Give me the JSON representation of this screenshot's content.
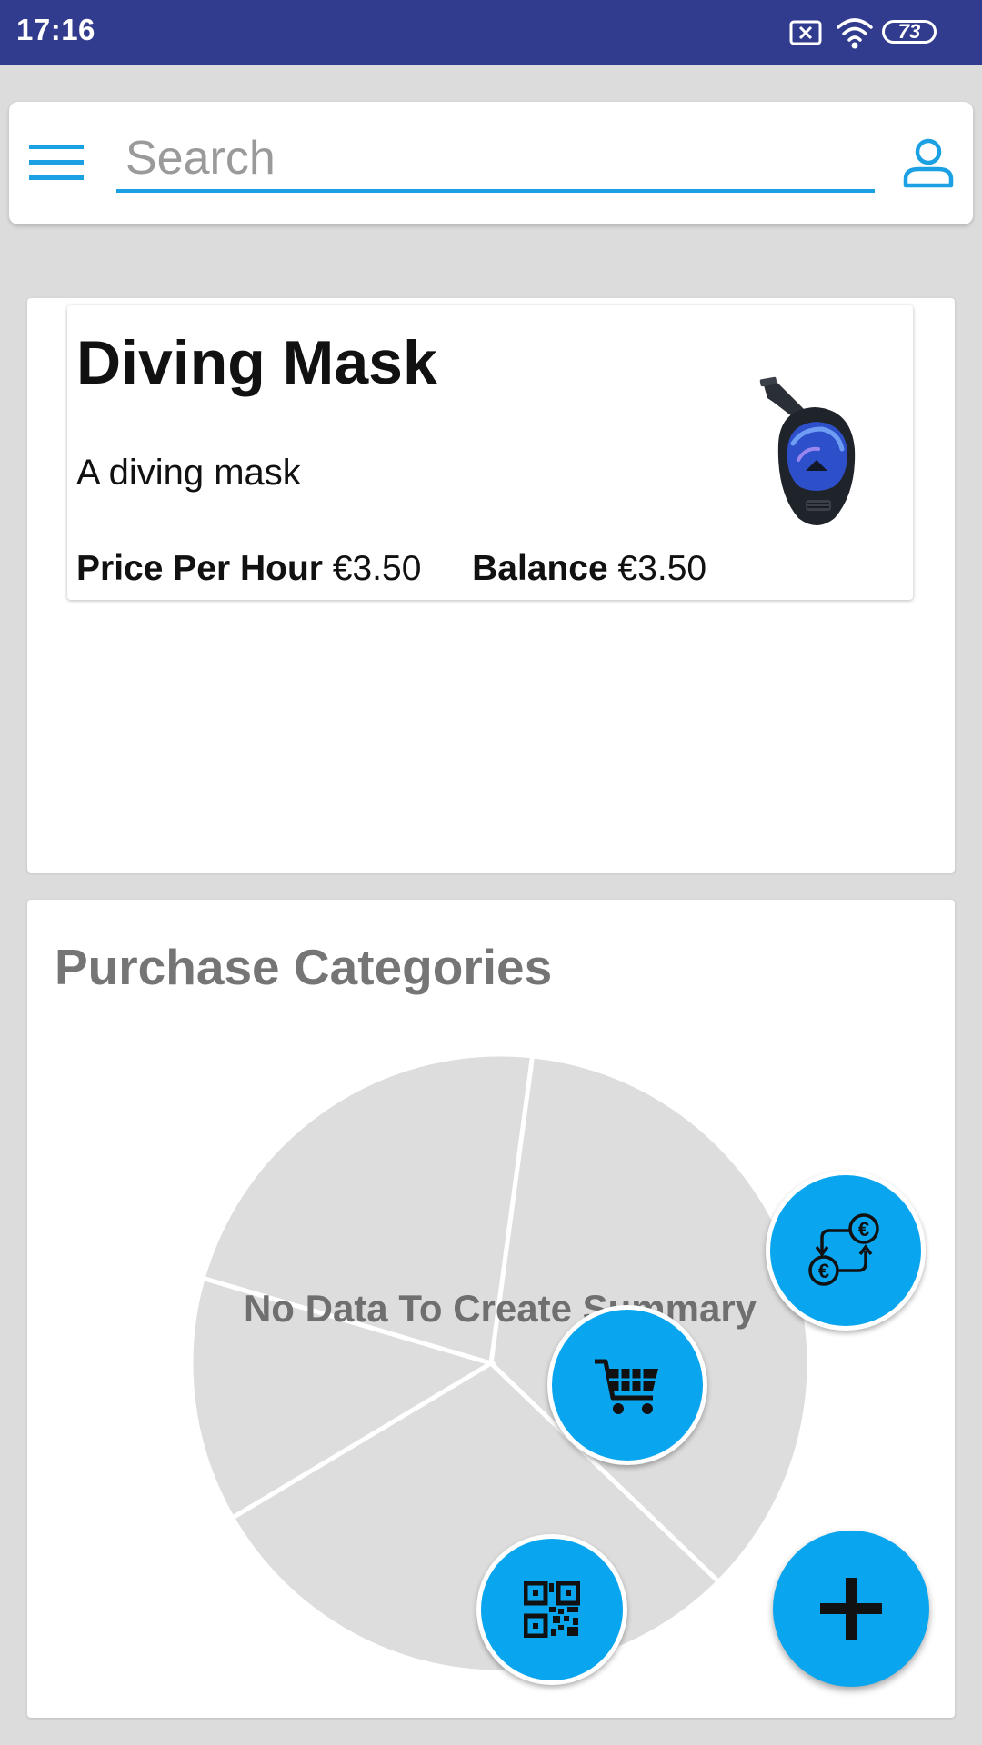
{
  "status_bar": {
    "time": "17:16",
    "battery": "73",
    "icons": [
      "sim-error-icon",
      "wifi-icon",
      "battery-icon"
    ],
    "background": "#323c8e"
  },
  "search": {
    "placeholder": "Search",
    "value": "",
    "underline_color": "#1aa0e3",
    "icons": [
      "hamburger-menu-icon",
      "profile-icon"
    ]
  },
  "item": {
    "title": "Diving Mask",
    "description": "A diving mask",
    "price_label": "Price Per Hour",
    "price_value": "€3.50",
    "balance_label": "Balance",
    "balance_value": "€3.50",
    "image": "diving-mask-image"
  },
  "purchase_categories": {
    "title": "Purchase Categories",
    "empty_message": "No Data To Create Summary"
  },
  "chart_data": {
    "type": "pie",
    "title": "Purchase Categories",
    "empty": true,
    "placeholder_slices": 4,
    "slice_color": "#dddddd",
    "annotation": "No Data To Create Summary"
  },
  "fabs": [
    {
      "name": "currency-exchange-button",
      "icon": "currency-exchange-icon"
    },
    {
      "name": "shopping-cart-button",
      "icon": "shopping-cart-icon"
    },
    {
      "name": "qr-code-button",
      "icon": "qr-code-icon"
    },
    {
      "name": "add-button",
      "icon": "plus-icon"
    }
  ],
  "accent_color": "#0aa5ef"
}
